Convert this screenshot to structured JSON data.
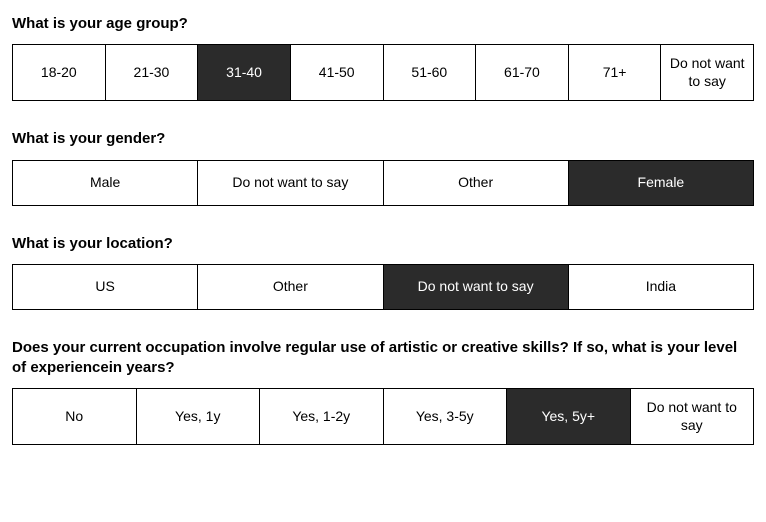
{
  "questions": [
    {
      "text": "What is your age group?",
      "options": [
        "18-20",
        "21-30",
        "31-40",
        "41-50",
        "51-60",
        "61-70",
        "71+",
        "Do not want to say"
      ],
      "selected": 2
    },
    {
      "text": "What is your gender?",
      "options": [
        "Male",
        "Do not want to say",
        "Other",
        "Female"
      ],
      "selected": 3
    },
    {
      "text": "What is your location?",
      "options": [
        "US",
        "Other",
        "Do not want to say",
        "India"
      ],
      "selected": 2
    },
    {
      "text": "Does your current occupation involve regular use of artistic or creative skills? If so, what is your level of experiencein years?",
      "options": [
        "No",
        "Yes, 1y",
        "Yes, 1-2y",
        "Yes, 3-5y",
        "Yes, 5y+",
        "Do not want to say"
      ],
      "selected": 4
    }
  ]
}
